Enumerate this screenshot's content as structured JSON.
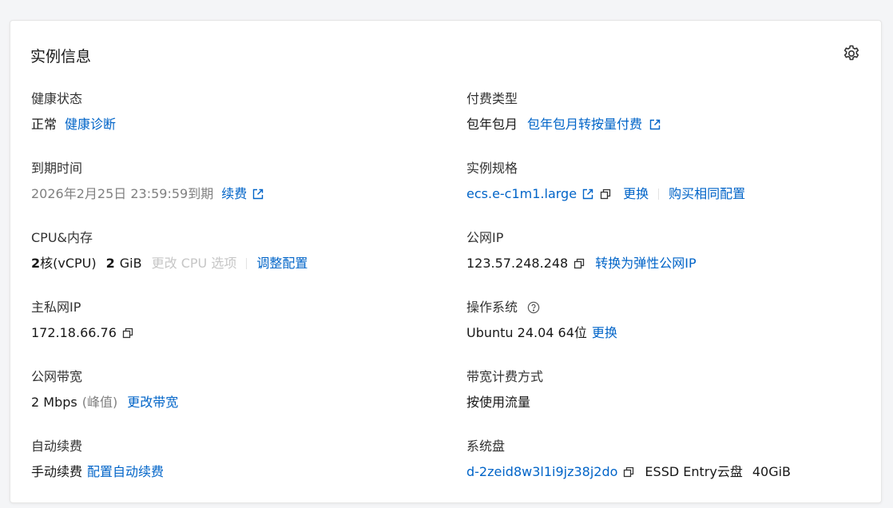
{
  "card": {
    "title": "实例信息",
    "settings_icon": "gear-icon"
  },
  "health": {
    "label": "健康状态",
    "value": "正常",
    "link": "健康诊断"
  },
  "billing_type": {
    "label": "付费类型",
    "value": "包年包月",
    "link": "包年包月转按量付费",
    "link_icon": "external-link-icon"
  },
  "expiry": {
    "label": "到期时间",
    "value": "2026年2月25日 23:59:59到期",
    "link": "续费",
    "link_icon": "external-link-icon"
  },
  "spec": {
    "label": "实例规格",
    "value": "ecs.e-c1m1.large",
    "value_icon": "external-link-icon",
    "copy_icon": "copy-icon",
    "change": "更换",
    "buy_same": "购买相同配置"
  },
  "cpu_mem": {
    "label": "CPU&内存",
    "cpu_num": "2",
    "cpu_unit": "核(vCPU)",
    "mem_num": "2",
    "mem_unit": "GiB",
    "cpu_option": "更改 CPU 选项",
    "adjust": "调整配置"
  },
  "public_ip": {
    "label": "公网IP",
    "value": "123.57.248.248",
    "copy_icon": "copy-icon",
    "link": "转换为弹性公网IP"
  },
  "private_ip": {
    "label": "主私网IP",
    "value": "172.18.66.76",
    "copy_icon": "copy-icon"
  },
  "os": {
    "label": "操作系统",
    "help_icon": "question-circle-icon",
    "value": "Ubuntu 24.04 64位",
    "link": "更换"
  },
  "bandwidth": {
    "label": "公网带宽",
    "value": "2 Mbps",
    "suffix": "(峰值)",
    "link": "更改带宽"
  },
  "bandwidth_billing": {
    "label": "带宽计费方式",
    "value": "按使用流量"
  },
  "auto_renew": {
    "label": "自动续费",
    "value": "手动续费",
    "link": "配置自动续费"
  },
  "system_disk": {
    "label": "系统盘",
    "id": "d-2zeid8w3l1i9jz38j2do",
    "copy_icon": "copy-icon",
    "type": "ESSD Entry云盘",
    "size": "40GiB"
  },
  "colors": {
    "link": "#0064c8",
    "text": "#181818",
    "muted": "#808080",
    "disabled": "#c6c6c6"
  }
}
